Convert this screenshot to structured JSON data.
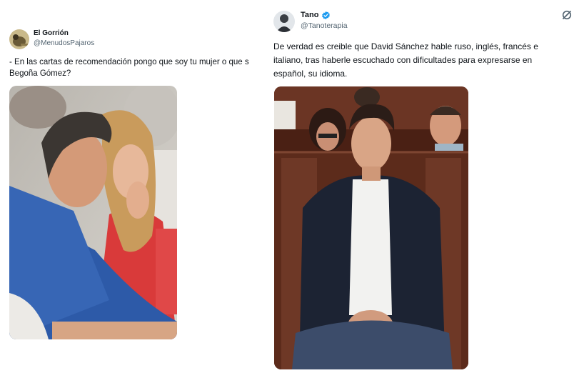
{
  "left_tweet": {
    "author_name": "El Gorrión",
    "author_handle": "@MenudosPajaros",
    "text_line1": "- En las cartas de recomendación pongo que soy tu mujer o que s",
    "text_line2": "Begoña Gómez?"
  },
  "right_tweet": {
    "author_name": "Tano",
    "author_handle": "@Tanoterapia",
    "text_line1": "De verdad es creible que David Sánchez hable ruso, inglés, francés e",
    "text_line2": "italiano, tras haberle escuchado con dificultades para expresarse en",
    "text_line3": "español, su idioma."
  },
  "colors": {
    "verified": "#1d9bf0",
    "handle": "#536471",
    "text": "#0f1419"
  },
  "icons": {
    "verified": "verified-badge-icon",
    "grok": "grok-icon"
  }
}
